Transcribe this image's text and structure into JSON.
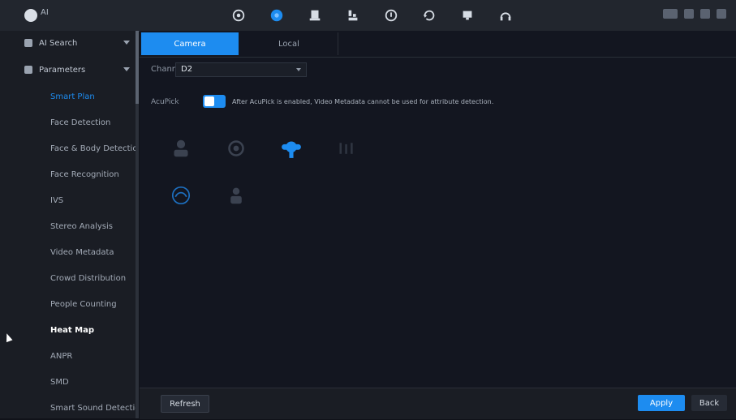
{
  "topbar": {
    "logo_text": "AI",
    "icons": [
      "settings-icon",
      "ai-icon",
      "storage-icon",
      "network-icon",
      "maintenance-icon",
      "backup-icon",
      "display-icon",
      "audio-icon"
    ]
  },
  "sidebar": {
    "heads": [
      "AI Search",
      "Parameters"
    ],
    "items": [
      "Smart Plan",
      "Face Detection",
      "Face & Body Detection",
      "Face Recognition",
      "IVS",
      "Stereo Analysis",
      "Video Metadata",
      "Crowd Distribution",
      "People Counting",
      "Heat Map",
      "ANPR",
      "SMD",
      "Smart Sound Detection"
    ]
  },
  "tabs": [
    "Camera",
    "Local"
  ],
  "channel": {
    "label": "Channel",
    "value": "D2"
  },
  "acupick": {
    "label": "AcuPick",
    "note": "After AcuPick is enabled, Video Metadata cannot be used for attribute detection."
  },
  "functions": [
    "face-detection-icon",
    "face-recognition-icon",
    "ivs-icon",
    "people-counting-icon",
    "heat-map-icon",
    "video-metadata-icon"
  ],
  "buttons": {
    "refresh": "Refresh",
    "apply": "Apply",
    "back": "Back"
  },
  "colors": {
    "accent": "#1d8cf0",
    "background": "#131620"
  }
}
